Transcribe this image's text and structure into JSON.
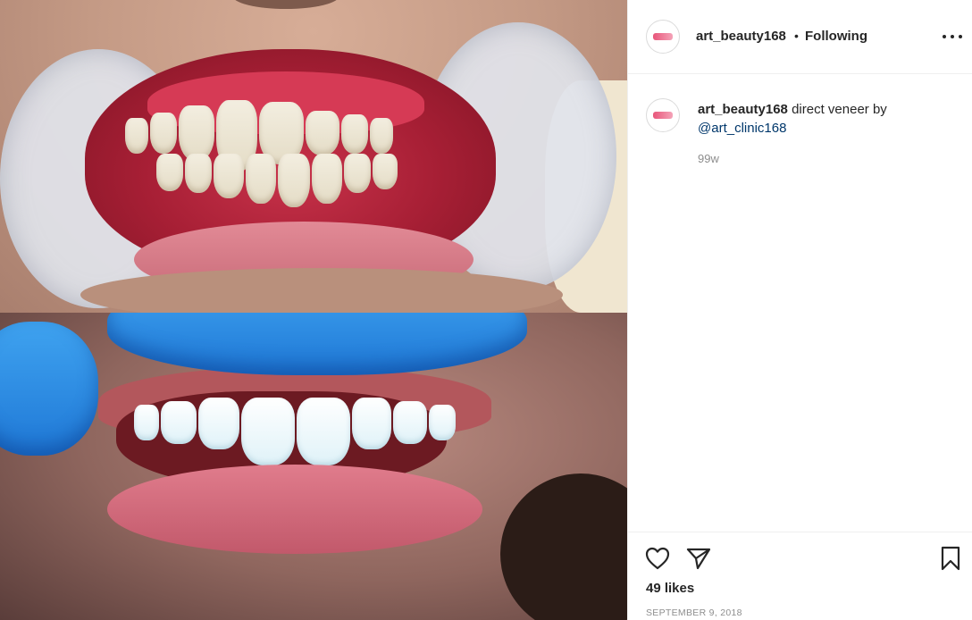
{
  "post": {
    "username": "art_beauty168",
    "separator": "•",
    "follow_status": "Following",
    "caption_text": "direct veneer by",
    "caption_mention": "@art_clinic168",
    "caption_age": "99w",
    "likes": "49 likes",
    "date": "SEPTEMBER 9, 2018"
  },
  "icons": {
    "more": "more-options-icon",
    "like": "heart-icon",
    "share": "paper-plane-icon",
    "save": "bookmark-icon"
  },
  "colors": {
    "text": "#262626",
    "muted": "#8e8e8e",
    "mention": "#00376b",
    "divider": "#efefef",
    "glove_blue": "#1f78d6"
  }
}
